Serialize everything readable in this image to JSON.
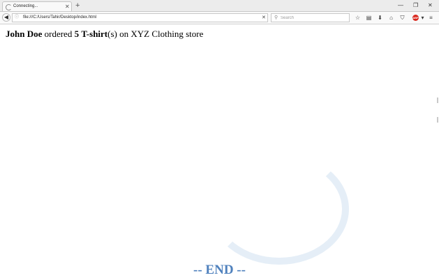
{
  "browser": {
    "tab": {
      "title": "Connecting..."
    },
    "url": "file:///C:/Users/Tahir/Desktop/index.html",
    "search_placeholder": "Search",
    "accent_color": "#d9261c"
  },
  "page": {
    "customer_name": "John Doe",
    "verb": "ordered",
    "quantity": "5",
    "product": "T-shirt",
    "suffix": "(s) on XYZ Clothing store",
    "end_text": "-- END --",
    "end_color": "#4f81bd"
  }
}
